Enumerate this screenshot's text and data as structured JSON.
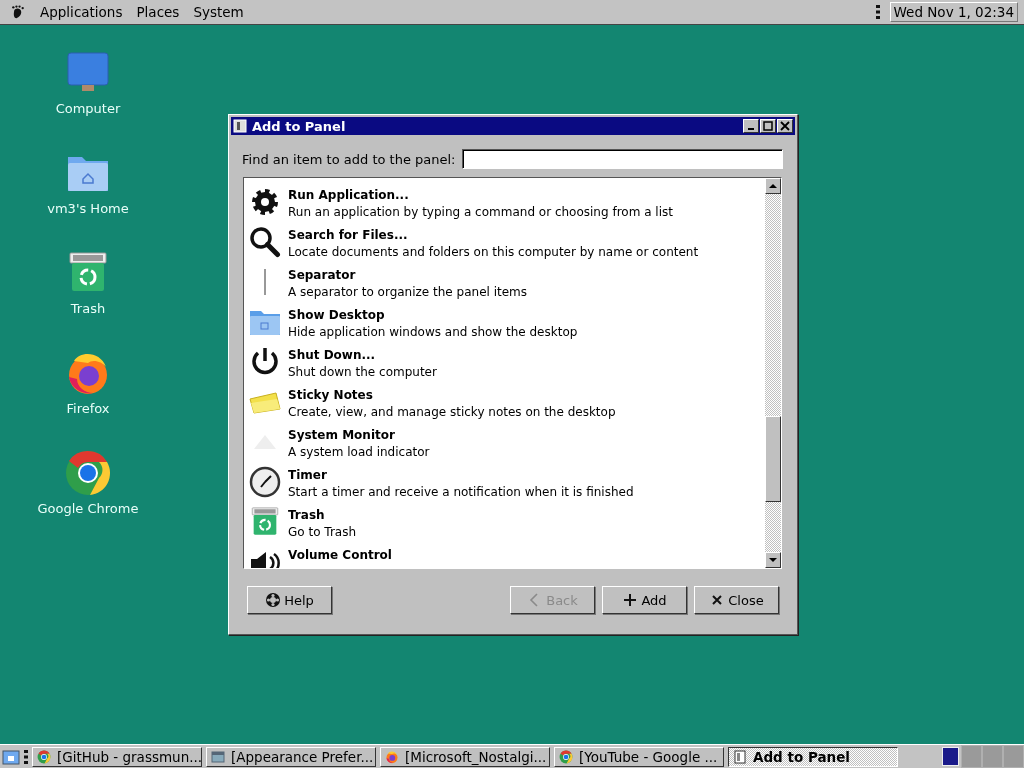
{
  "top_panel": {
    "menus": [
      "Applications",
      "Places",
      "System"
    ],
    "clock": "Wed Nov 1, 02:34"
  },
  "desktop_icons": [
    {
      "kind": "computer",
      "label": "Computer"
    },
    {
      "kind": "home",
      "label": "vm3's Home"
    },
    {
      "kind": "trash",
      "label": "Trash"
    },
    {
      "kind": "firefox",
      "label": "Firefox"
    },
    {
      "kind": "chrome",
      "label": "Google Chrome"
    }
  ],
  "dialog": {
    "title": "Add to Panel",
    "search_label": "Find an item to add to the panel:",
    "items": [
      {
        "kind": "gear",
        "title": "Run Application...",
        "description": "Run an application by typing a command or choosing from a list"
      },
      {
        "kind": "search",
        "title": "Search for Files...",
        "description": "Locate documents and folders on this computer by name or content"
      },
      {
        "kind": "separator",
        "title": "Separator",
        "description": "A separator to organize the panel items"
      },
      {
        "kind": "folder",
        "title": "Show Desktop",
        "description": "Hide application windows and show the desktop"
      },
      {
        "kind": "power",
        "title": "Shut Down...",
        "description": "Shut down the computer"
      },
      {
        "kind": "notes",
        "title": "Sticky Notes",
        "description": "Create, view, and manage sticky notes on the desktop"
      },
      {
        "kind": "monitor",
        "title": "System Monitor",
        "description": "A system load indicator"
      },
      {
        "kind": "timer",
        "title": "Timer",
        "description": "Start a timer and receive a notification when it is finished"
      },
      {
        "kind": "trash",
        "title": "Trash",
        "description": "Go to Trash"
      },
      {
        "kind": "speaker",
        "title": "Volume Control"
      }
    ],
    "buttons": [
      {
        "kind": "help",
        "label": "Help",
        "disabled": false
      },
      {
        "kind": "back",
        "label": "Back",
        "disabled": true
      },
      {
        "kind": "add",
        "label": "Add",
        "disabled": false
      },
      {
        "kind": "close",
        "label": "Close",
        "disabled": false
      }
    ]
  },
  "taskbar": {
    "windows": [
      {
        "kind": "chrome",
        "label": "[GitHub - grassmun...",
        "selected": false
      },
      {
        "kind": "appearance",
        "label": "[Appearance Prefer...",
        "selected": false
      },
      {
        "kind": "firefox",
        "label": "[Microsoft_Nostalgi...",
        "selected": false
      },
      {
        "kind": "chrome",
        "label": "[YouTube - Google ...",
        "selected": false
      },
      {
        "kind": "dialog",
        "label": "Add to Panel",
        "selected": true
      }
    ],
    "workspaces": [
      {
        "selected": true
      },
      {
        "selected": false
      },
      {
        "selected": false
      },
      {
        "selected": false
      }
    ]
  }
}
